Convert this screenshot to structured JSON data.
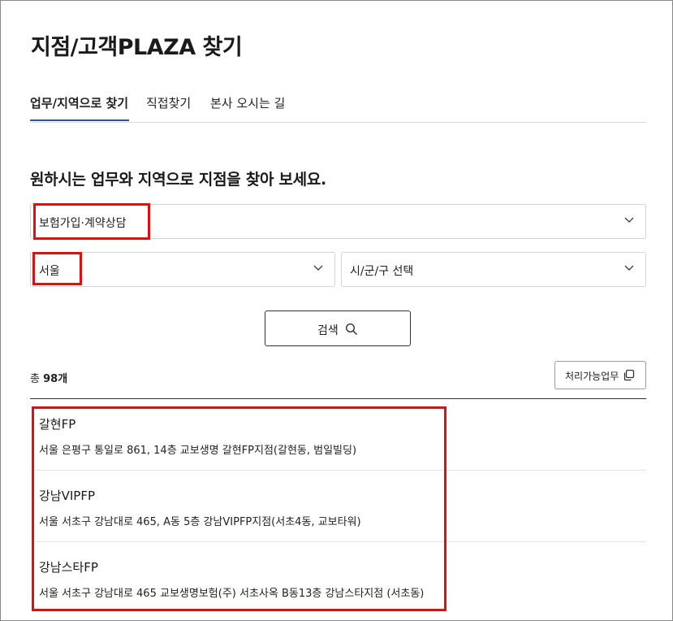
{
  "page": {
    "title": "지점/고객PLAZA 찾기"
  },
  "tabs": [
    {
      "label": "업무/지역으로 찾기",
      "active": true
    },
    {
      "label": "직접찾기",
      "active": false
    },
    {
      "label": "본사 오시는 길",
      "active": false
    }
  ],
  "section": {
    "subtitle": "원하시는 업무와 지역으로 지점을 찾아 보세요."
  },
  "filters": {
    "business": "보험가입·계약상담",
    "city": "서울",
    "district": "시/군/구 선택"
  },
  "search": {
    "label": "검색"
  },
  "results": {
    "count_prefix": "총",
    "count_value": "98개",
    "biz_button": "처리가능업무",
    "items": [
      {
        "name": "갈현FP",
        "address": "서울 은평구 통일로 861, 14층 교보생명 갈현FP지점(갈현동, 범일빌딩)"
      },
      {
        "name": "강남VIPFP",
        "address": "서울 서초구 강남대로 465, A동 5층 강남VIPFP지점(서초4동, 교보타워)"
      },
      {
        "name": "강남스타FP",
        "address": "서울 서초구 강남대로 465 교보생명보험(주) 서초사옥 B동13층 강남스타지점 (서초동)"
      }
    ]
  },
  "colors": {
    "accent": "#1e5aa8",
    "highlight": "#e01010"
  }
}
